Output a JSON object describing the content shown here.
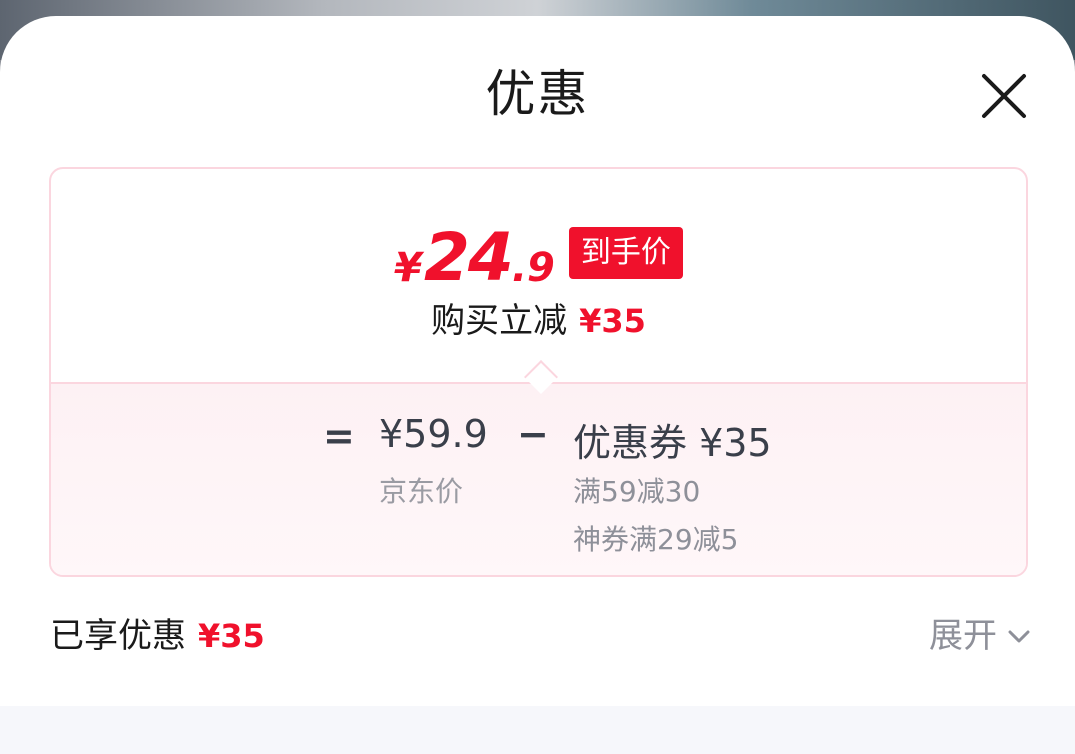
{
  "sheet": {
    "title": "优惠",
    "close_icon": "close-icon"
  },
  "summary": {
    "price_currency": "¥",
    "price_integer": "24",
    "price_decimal": ".9",
    "final_price_badge": "到手价",
    "instant_discount_label": "购买立减",
    "instant_discount_value": "¥35"
  },
  "breakdown": {
    "equals_symbol": "=",
    "original_price": "¥59.9",
    "original_price_label": "京东价",
    "minus_symbol": "−",
    "coupon_title": "优惠券 ¥35",
    "coupon_details": [
      "满59减30",
      "神券满29减5"
    ]
  },
  "footer": {
    "enjoyed_label": "已享优惠",
    "enjoyed_value": "¥35",
    "expand_label": "展开",
    "expand_icon": "chevron-down-icon"
  },
  "colors": {
    "accent_red": "#f0112c",
    "card_border": "#fbd6df",
    "muted_text": "#8e9099"
  }
}
